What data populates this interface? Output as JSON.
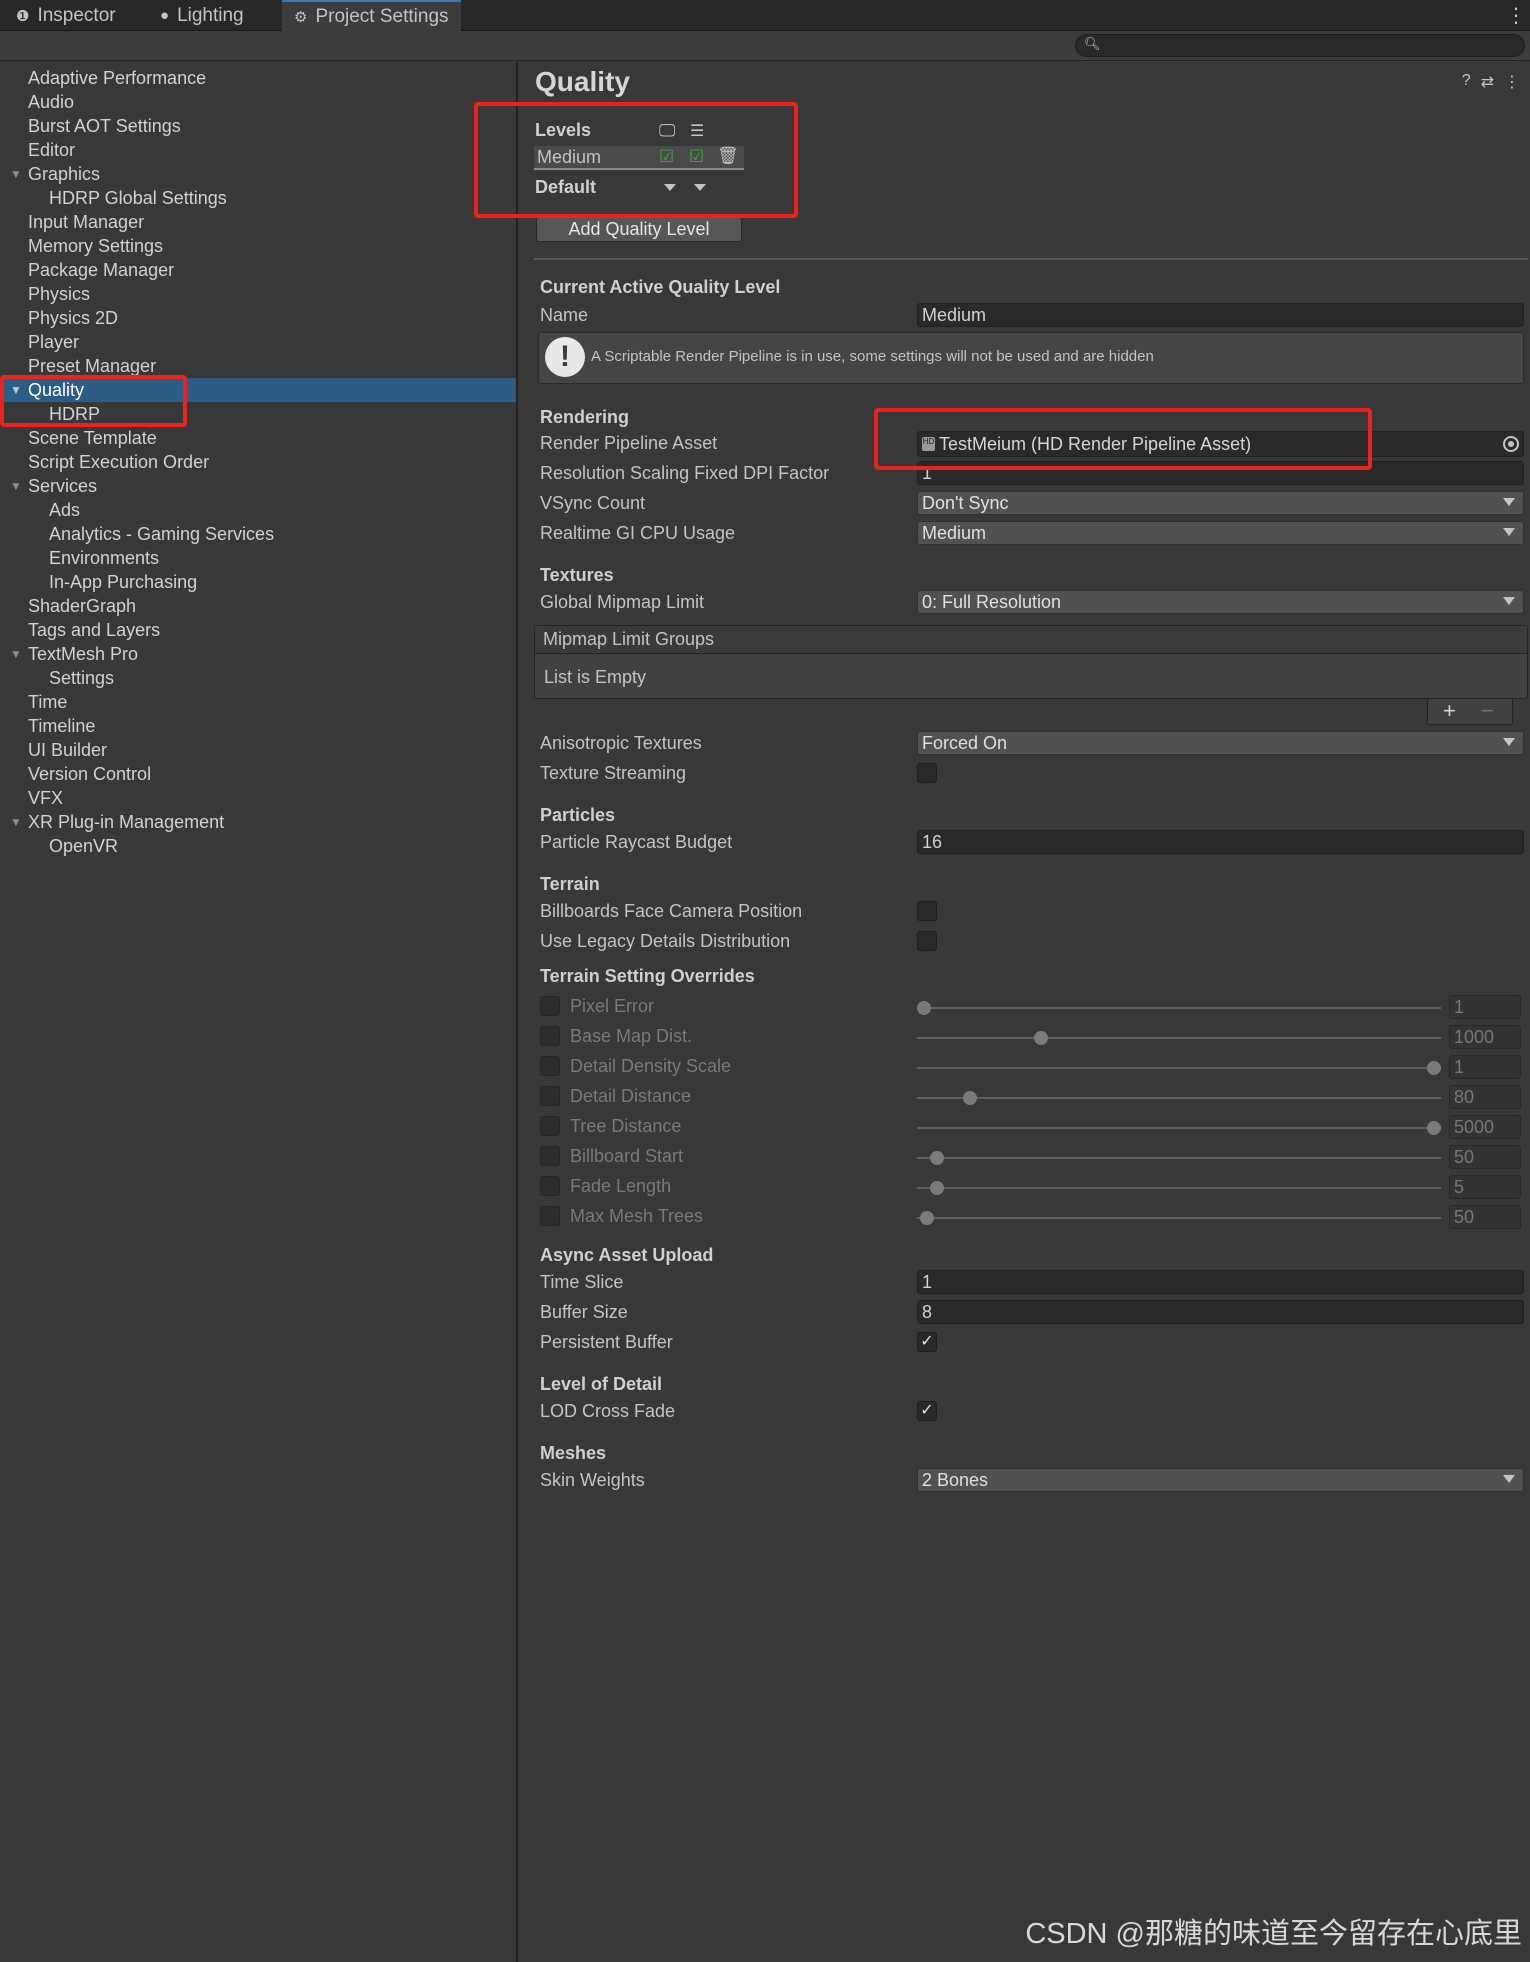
{
  "tabs": [
    {
      "label": "Inspector",
      "icon": "info-icon"
    },
    {
      "label": "Lighting",
      "icon": "bulb-icon"
    },
    {
      "label": "Project Settings",
      "icon": "gear-icon"
    }
  ],
  "sidebar": {
    "items": [
      {
        "label": "Adaptive Performance"
      },
      {
        "label": "Audio"
      },
      {
        "label": "Burst AOT Settings"
      },
      {
        "label": "Editor"
      },
      {
        "label": "Graphics"
      },
      {
        "label": "HDRP Global Settings"
      },
      {
        "label": "Input Manager"
      },
      {
        "label": "Memory Settings"
      },
      {
        "label": "Package Manager"
      },
      {
        "label": "Physics"
      },
      {
        "label": "Physics 2D"
      },
      {
        "label": "Player"
      },
      {
        "label": "Preset Manager"
      },
      {
        "label": "Quality"
      },
      {
        "label": "HDRP"
      },
      {
        "label": "Scene Template"
      },
      {
        "label": "Script Execution Order"
      },
      {
        "label": "Services"
      },
      {
        "label": "Ads"
      },
      {
        "label": "Analytics - Gaming Services"
      },
      {
        "label": "Environments"
      },
      {
        "label": "In-App Purchasing"
      },
      {
        "label": "ShaderGraph"
      },
      {
        "label": "Tags and Layers"
      },
      {
        "label": "TextMesh Pro"
      },
      {
        "label": "Settings"
      },
      {
        "label": "Time"
      },
      {
        "label": "Timeline"
      },
      {
        "label": "UI Builder"
      },
      {
        "label": "Version Control"
      },
      {
        "label": "VFX"
      },
      {
        "label": "XR Plug-in Management"
      },
      {
        "label": "OpenVR"
      }
    ],
    "selected": "Quality"
  },
  "main": {
    "title": "Quality",
    "levels": {
      "heading": "Levels",
      "level_name": "Medium",
      "default_label": "Default",
      "add_button": "Add Quality Level"
    },
    "current": {
      "heading": "Current Active Quality Level",
      "name_label": "Name",
      "name_value": "Medium",
      "help_text": "A Scriptable Render Pipeline is in use, some settings will not be used and are hidden"
    },
    "rendering": {
      "heading": "Rendering",
      "rpa_label": "Render Pipeline Asset",
      "rpa_value": "TestMeium (HD Render Pipeline Asset)",
      "dpi_label": "Resolution Scaling Fixed DPI Factor",
      "dpi_value": "1",
      "vsync_label": "VSync Count",
      "vsync_value": "Don't Sync",
      "gi_label": "Realtime GI CPU Usage",
      "gi_value": "Medium"
    },
    "textures": {
      "heading": "Textures",
      "mip_label": "Global Mipmap Limit",
      "mip_value": "0: Full Resolution",
      "groups_label": "Mipmap Limit Groups",
      "groups_empty": "List is Empty",
      "aniso_label": "Anisotropic Textures",
      "aniso_value": "Forced On",
      "streaming_label": "Texture Streaming"
    },
    "particles": {
      "heading": "Particles",
      "budget_label": "Particle Raycast Budget",
      "budget_value": "16"
    },
    "terrain": {
      "heading": "Terrain",
      "billboards_label": "Billboards Face Camera Position",
      "legacy_label": "Use Legacy Details Distribution"
    },
    "overrides": {
      "heading": "Terrain Setting Overrides",
      "rows": [
        {
          "label": "Pixel Error",
          "value": "1",
          "level": 0.0
        },
        {
          "label": "Base Map Dist.",
          "value": "1000",
          "level": 0.23
        },
        {
          "label": "Detail Density Scale",
          "value": "1",
          "level": 1.0
        },
        {
          "label": "Detail Distance",
          "value": "80",
          "level": 0.09
        },
        {
          "label": "Tree Distance",
          "value": "5000",
          "level": 1.0
        },
        {
          "label": "Billboard Start",
          "value": "50",
          "level": 0.025
        },
        {
          "label": "Fade Length",
          "value": "5",
          "level": 0.025
        },
        {
          "label": "Max Mesh Trees",
          "value": "50",
          "level": 0.005
        }
      ]
    },
    "async": {
      "heading": "Async Asset Upload",
      "slice_label": "Time Slice",
      "slice_value": "1",
      "buffer_label": "Buffer Size",
      "buffer_value": "8",
      "persistent_label": "Persistent Buffer"
    },
    "lod": {
      "heading": "Level of Detail",
      "crossfade_label": "LOD Cross Fade"
    },
    "meshes": {
      "heading": "Meshes",
      "skin_label": "Skin Weights",
      "skin_value": "2 Bones"
    }
  },
  "watermark": "CSDN @那糖的味道至今留存在心底里",
  "colors": {
    "accent": "#2c5d87",
    "annotation": "#e8241d",
    "check_green": "#3ea83e"
  }
}
